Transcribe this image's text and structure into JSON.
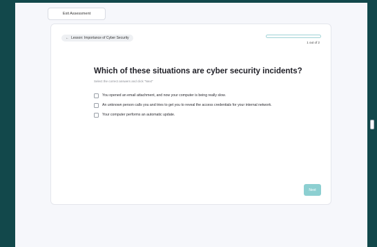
{
  "header": {
    "exit_label": "Exit Assessment"
  },
  "lesson": {
    "breadcrumb_arrow": "←",
    "breadcrumb_label": "Lesson: Importance of Cyber Security"
  },
  "progress": {
    "label": "1 out of 2",
    "fraction": 0.0
  },
  "question": {
    "title": "Which of these situations are cyber security incidents?",
    "instruction": "Select the correct answers and click \"Next\""
  },
  "options": [
    {
      "label": "You opened an email attachment, and now your computer is being really slow.",
      "checked": false
    },
    {
      "label": "An unknown person calls you and tries to get you to reveal the access credentials for your internal network.",
      "checked": false
    },
    {
      "label": "Your computer performs an automatic update.",
      "checked": false
    }
  ],
  "footer": {
    "next_label": "Next"
  },
  "colors": {
    "background": "#12484b",
    "accent": "#8ccfd1",
    "page": "#f6f7fb"
  }
}
